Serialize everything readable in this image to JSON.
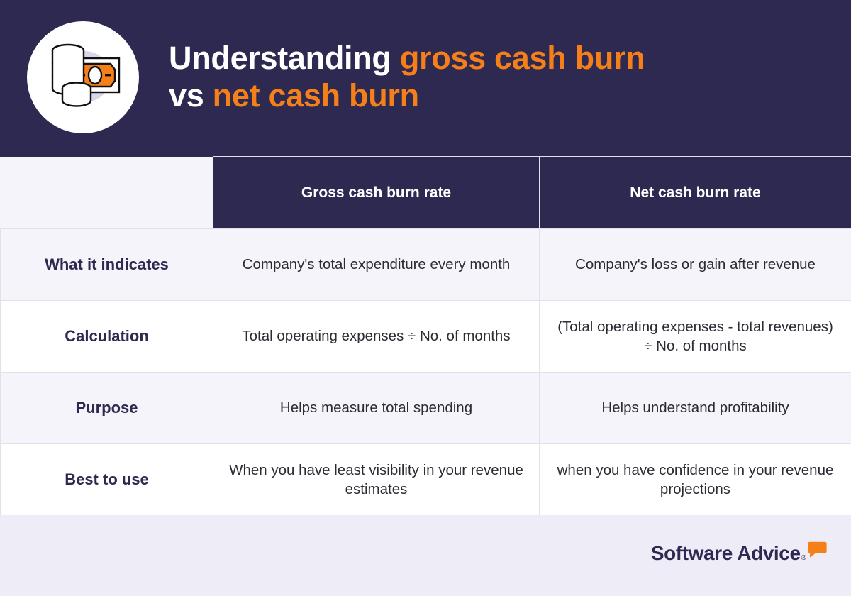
{
  "hero": {
    "icon_name": "cash-and-coins-icon",
    "title_line1_plain": "Understanding ",
    "title_line1_accent": "gross cash burn",
    "title_line2_plain": "vs ",
    "title_line2_accent": "net cash burn"
  },
  "colors": {
    "navy": "#2e2950",
    "orange": "#f5801a",
    "page_background": "#eeecf7",
    "row_tint": "#f5f4fa",
    "row_white": "#ffffff",
    "grid_line": "#e2e0ec",
    "body_text": "#2b2b34",
    "icon_inner_circle": "#d9d6ea"
  },
  "table": {
    "headers": [
      "",
      "Gross cash burn rate",
      "Net cash burn rate"
    ],
    "rows": [
      {
        "label": "What it indicates",
        "gross": "Company's total expenditure every month",
        "net": "Company's loss or gain after revenue"
      },
      {
        "label": "Calculation",
        "gross": "Total operating expenses ÷ No. of months",
        "net": "(Total operating expenses - total revenues) ÷ No. of months"
      },
      {
        "label": "Purpose",
        "gross": "Helps measure total spending",
        "net": "Helps understand profitability"
      },
      {
        "label": "Best to use",
        "gross": "When you have least visibility in your revenue estimates",
        "net": "when you have confidence in your revenue projections"
      }
    ]
  },
  "footer": {
    "logo_text": "Software Advice",
    "logo_registered": "®",
    "logo_bubble_name": "speech-bubble-icon"
  }
}
